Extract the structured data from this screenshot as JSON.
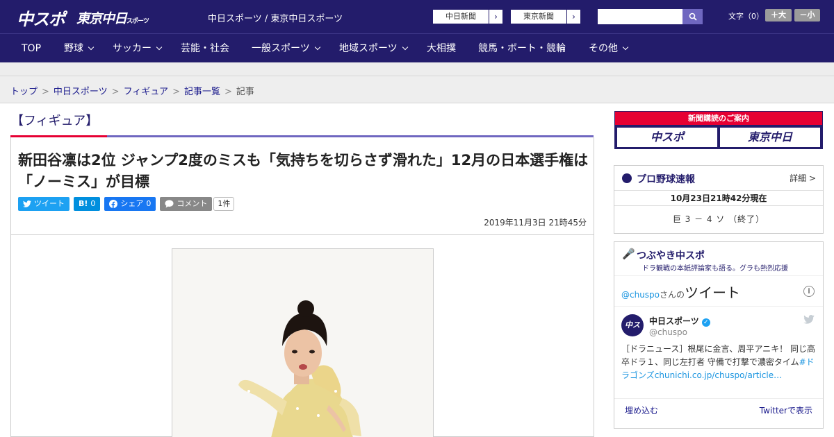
{
  "header": {
    "logo_chuspo": "中スポ",
    "logo_tokyo": "東京中日",
    "logo_tokyo_small": "スポーツ",
    "site_title": "中日スポーツ / 東京中日スポーツ",
    "btn_chunichi": "中日新聞",
    "btn_tokyo": "東京新聞",
    "arrow": "›",
    "search_placeholder": "",
    "fontsize_label": "文字（0）",
    "fontsize_plus": "＋大",
    "fontsize_minus": "－小"
  },
  "nav": {
    "items": [
      {
        "label": "TOP"
      },
      {
        "label": "野球"
      },
      {
        "label": "サッカー"
      },
      {
        "label": "芸能・社会"
      },
      {
        "label": "一般スポーツ"
      },
      {
        "label": "地域スポーツ"
      },
      {
        "label": "大相撲"
      },
      {
        "label": "競馬・ボート・競輪"
      },
      {
        "label": "その他"
      }
    ]
  },
  "breadcrumb": {
    "items": [
      "トップ",
      "中日スポーツ",
      "フィギュア",
      "記事一覧"
    ],
    "current": "記事",
    "sep": ">"
  },
  "article": {
    "category": "【フィギュア】",
    "headline": "新田谷凛は2位 ジャンプ2度のミスも「気持ちを切らさず滑れた」12月の日本選手権は「ノーミス」が目標",
    "share": {
      "tweet": "ツイート",
      "hatena_icon": "B!",
      "hatena_count": "0",
      "fb": "シェア",
      "fb_count": "0",
      "comment": "コメント",
      "comment_count": "1件"
    },
    "date": "2019年11月3日 21時45分"
  },
  "sidebar": {
    "ad_title": "新聞購読のご案内",
    "ad_logo1": "中スポ",
    "ad_logo2": "東京中日",
    "baseball": {
      "title": "プロ野球速報",
      "more": "詳細 >",
      "time": "10月23日21時42分現在",
      "score": "巨 3 － 4 ソ （終了）"
    },
    "tweets": {
      "title": "つぶやき中スポ",
      "subtitle": "ドラ観戦の本紙評論家も語る。グラも熱烈応援",
      "handle": "@chuspo",
      "handle_suffix": "さんの",
      "heading": "ツイート",
      "info": "i",
      "user_name": "中日スポーツ",
      "verified": "✓",
      "user_handle": "@chuspo",
      "avatar_text": "中スポ",
      "body": "［ドラニュース］根尾に金言、周平アニキ！ 同じ高卒ドラ１、同じ左打者 守備で打撃で濃密タイム",
      "body_link": "#ドラゴンズchunichi.co.jp/chuspo/article…",
      "embed": "埋め込む",
      "view": "Twitterで表示"
    }
  }
}
